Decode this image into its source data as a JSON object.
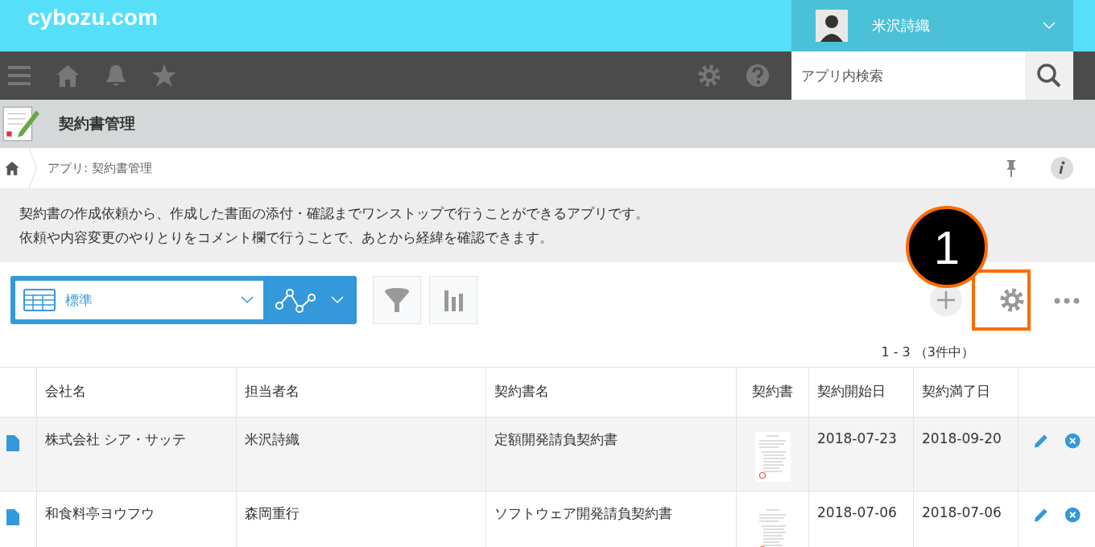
{
  "header": {
    "logo": "cybozu.com",
    "user_name": "米沢詩織"
  },
  "search": {
    "placeholder": "アプリ内検索"
  },
  "app": {
    "title": "契約書管理"
  },
  "breadcrumb": {
    "text": "アプリ: 契約書管理"
  },
  "description": [
    "契約書の作成依頼から、作成した書面の添付・確認までワンストップで行うことができるアプリです。",
    "依頼や内容変更のやりとりをコメント欄で行うことで、あとから経緯を確認できます。"
  ],
  "view_selector": {
    "value": "標準"
  },
  "annotation": {
    "number": "1"
  },
  "record_count": "1 - 3 （3件中）",
  "table": {
    "columns": [
      "会社名",
      "担当者名",
      "契約書名",
      "契約書",
      "契約開始日",
      "契約満了日"
    ],
    "rows": [
      {
        "company": "株式会社 シア・サッテ",
        "person": "米沢詩織",
        "contract": "定額開発請負契約書",
        "start": "2018-07-23",
        "end": "2018-09-20"
      },
      {
        "company": "和食料亭ヨウフウ",
        "person": "森岡重行",
        "contract": "ソフトウェア開発請負契約書",
        "start": "2018-07-06",
        "end": "2018-07-06"
      }
    ]
  }
}
